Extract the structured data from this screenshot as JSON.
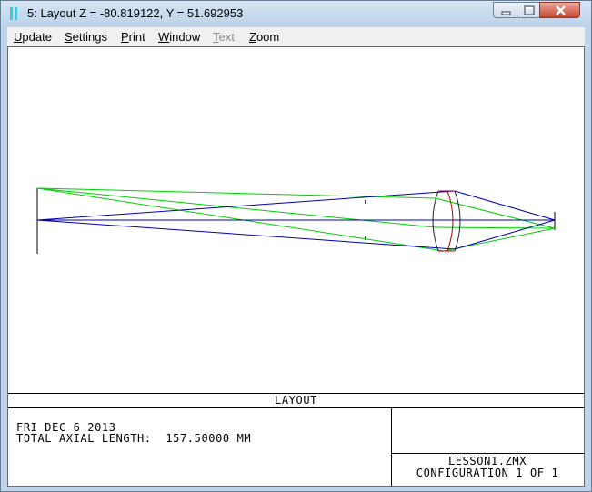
{
  "window": {
    "title": "5: Layout Z = -80.819122, Y = 51.692953"
  },
  "menu": [
    {
      "key": "U",
      "rest": "pdate",
      "enabled": true
    },
    {
      "key": "S",
      "rest": "ettings",
      "enabled": true
    },
    {
      "key": "P",
      "rest": "rint",
      "enabled": true
    },
    {
      "key": "W",
      "rest": "indow",
      "enabled": true
    },
    {
      "key": "T",
      "rest": "ext",
      "enabled": false
    },
    {
      "key": "Z",
      "rest": "oom",
      "enabled": true
    }
  ],
  "plot": {
    "ray_colors": {
      "field1": "#0000b0",
      "field2": "#00d000",
      "lens_front": "#202020",
      "lens_back": "#b00000"
    }
  },
  "footer": {
    "section_title": "LAYOUT",
    "date_line": "FRI DEC 6 2013",
    "length_line": "TOTAL AXIAL LENGTH:  157.50000 MM",
    "file_name": "LESSON1.ZMX",
    "configuration": "CONFIGURATION 1 OF 1"
  },
  "icons": {
    "app": "zemax-app-icon",
    "minimize": "minimize-icon",
    "maximize": "maximize-icon",
    "close": "close-icon"
  }
}
